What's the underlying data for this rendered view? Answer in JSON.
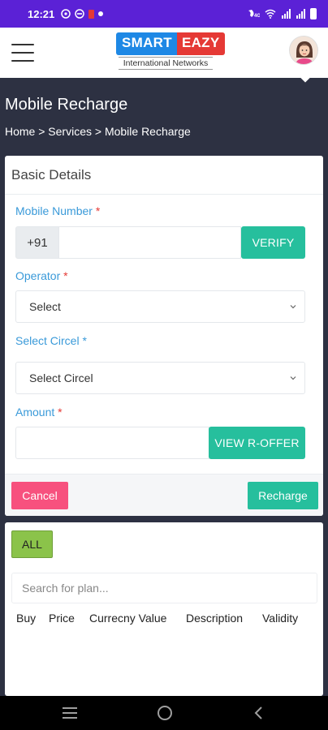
{
  "status_bar": {
    "time": "12:21",
    "icons_left": [
      "whatsapp-icon",
      "circle-minus-icon",
      "red-battery-icon",
      "dot-icon"
    ],
    "icons_right": [
      "volte-icon",
      "wifi-icon",
      "signal-icon",
      "signal-icon",
      "battery-icon"
    ]
  },
  "header": {
    "menu_icon": "hamburger-menu-icon",
    "logo_word1": "SMART",
    "logo_word2": "EAZY",
    "logo_sub": "International Networks",
    "avatar_icon": "user-avatar"
  },
  "banner": {
    "title": "Mobile Recharge",
    "breadcrumb": "Home > Services > Mobile Recharge"
  },
  "form": {
    "section_title": "Basic Details",
    "mobile_label": "Mobile Number",
    "required_mark": "*",
    "country_code": "+91",
    "mobile_value": "",
    "verify_label": "VERIFY",
    "operator_label": "Operator",
    "operator_value": "Select",
    "circle_label": "Select Circel *",
    "circle_value": "Select Circel",
    "amount_label": "Amount",
    "amount_value": "",
    "offer_label": "VIEW R-OFFER",
    "cancel_label": "Cancel",
    "recharge_label": "Recharge"
  },
  "plans": {
    "filter_all": "ALL",
    "search_placeholder": "Search for plan...",
    "columns": [
      "Buy",
      "Price",
      "Currecny Value",
      "Description",
      "Validity"
    ]
  },
  "colors": {
    "status_bar": "#5b21d6",
    "banner": "#2d3142",
    "teal": "#26bf9d",
    "cancel": "#f7517e",
    "all_button": "#8bc34a",
    "label_blue": "#3a9ad9",
    "required_red": "#e53935"
  },
  "nav_bar": {
    "icons": [
      "recent-apps-icon",
      "home-icon",
      "back-icon"
    ]
  }
}
